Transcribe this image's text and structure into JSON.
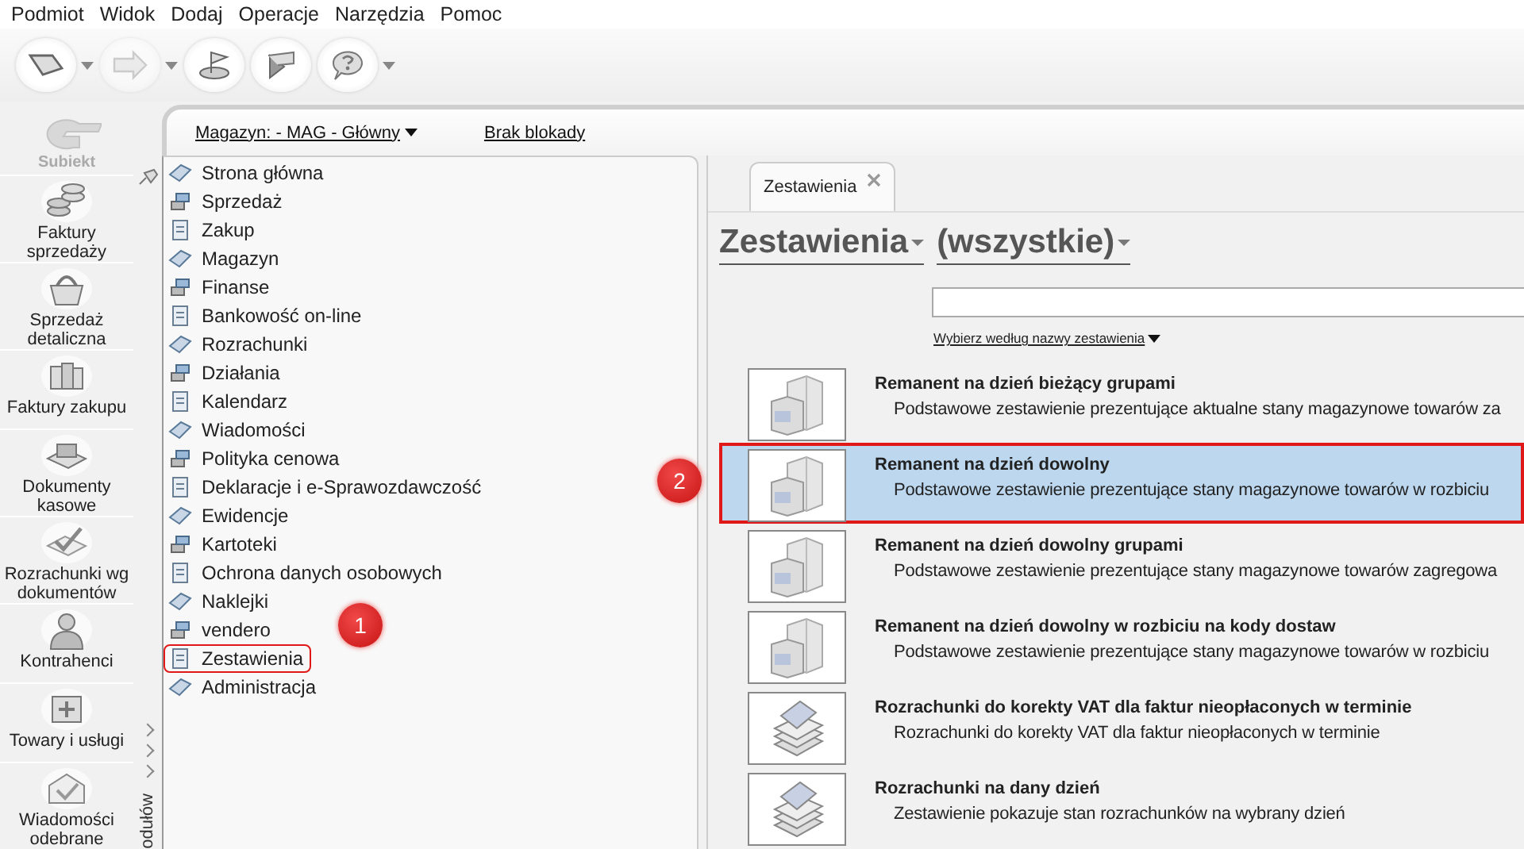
{
  "menu": [
    "Podmiot",
    "Widok",
    "Dodaj",
    "Operacje",
    "Narzędzia",
    "Pomoc"
  ],
  "toolbar_buttons": [
    {
      "dropdown": true,
      "disabled": false
    },
    {
      "dropdown": true,
      "disabled": true
    },
    {
      "dropdown": false,
      "disabled": false
    },
    {
      "dropdown": false,
      "disabled": false
    },
    {
      "dropdown": true,
      "disabled": false
    }
  ],
  "app_logo": {
    "name": "Subiekt"
  },
  "sidebar": {
    "items": [
      {
        "label": "Faktury sprzedaży"
      },
      {
        "label": "Sprzedaż detaliczna"
      },
      {
        "label": "Faktury zakupu"
      },
      {
        "label": "Dokumenty kasowe"
      },
      {
        "label": "Rozrachunki wg dokumentów"
      },
      {
        "label": "Kontrahenci"
      },
      {
        "label": "Towary i usługi"
      },
      {
        "label": "Wiadomości odebrane"
      }
    ]
  },
  "module_header": {
    "warehouse": "Magazyn: - MAG - Główny",
    "lock_status": "Brak blokady"
  },
  "module_strip": {
    "label": "odułów"
  },
  "modules": [
    {
      "label": "Strona główna",
      "selected": false
    },
    {
      "label": "Sprzedaż",
      "selected": false
    },
    {
      "label": "Zakup",
      "selected": false
    },
    {
      "label": "Magazyn",
      "selected": false
    },
    {
      "label": "Finanse",
      "selected": false
    },
    {
      "label": "Bankowość on-line",
      "selected": false
    },
    {
      "label": "Rozrachunki",
      "selected": false
    },
    {
      "label": "Działania",
      "selected": false
    },
    {
      "label": "Kalendarz",
      "selected": false
    },
    {
      "label": "Wiadomości",
      "selected": false
    },
    {
      "label": "Polityka cenowa",
      "selected": false
    },
    {
      "label": "Deklaracje i e-Sprawozdawczość",
      "selected": false
    },
    {
      "label": "Ewidencje",
      "selected": false
    },
    {
      "label": "Kartoteki",
      "selected": false
    },
    {
      "label": "Ochrona danych osobowych",
      "selected": false
    },
    {
      "label": "Naklejki",
      "selected": false
    },
    {
      "label": "vendero",
      "selected": false
    },
    {
      "label": "Zestawienia",
      "selected": true,
      "callout": "1"
    },
    {
      "label": "Administracja",
      "selected": false
    }
  ],
  "tabs": [
    {
      "label": "Zestawienia",
      "selected": true
    }
  ],
  "heading": {
    "category": "Zestawienia",
    "filter": "(wszystkie)"
  },
  "sort_link": "Wybierz według nazwy zestawienia",
  "reports": [
    {
      "kind": "stock",
      "title": "Remanent na dzień bieżący grupami",
      "description": "Podstawowe zestawienie prezentujące aktualne stany magazynowe towarów za",
      "selected": false
    },
    {
      "kind": "stock",
      "title": "Remanent na dzień dowolny",
      "description": "Podstawowe zestawienie prezentujące stany magazynowe towarów w rozbiciu",
      "selected": true,
      "callout": "2"
    },
    {
      "kind": "stock",
      "title": "Remanent na dzień dowolny grupami",
      "description": "Podstawowe zestawienie prezentujące stany magazynowe towarów zagregowa",
      "selected": false
    },
    {
      "kind": "stock",
      "title": "Remanent na dzień dowolny w rozbiciu na kody dostaw",
      "description": "Podstawowe zestawienie prezentujące stany magazynowe towarów w rozbiciu",
      "selected": false
    },
    {
      "kind": "money",
      "title": "Rozrachunki do korekty VAT dla faktur nieopłaconych w terminie",
      "description": "Rozrachunki do korekty VAT dla faktur nieopłaconych w terminie",
      "selected": false
    },
    {
      "kind": "money",
      "title": "Rozrachunki na dany dzień",
      "description": "Zestawienie pokazuje stan rozrachunków na wybrany dzień",
      "selected": false
    }
  ]
}
